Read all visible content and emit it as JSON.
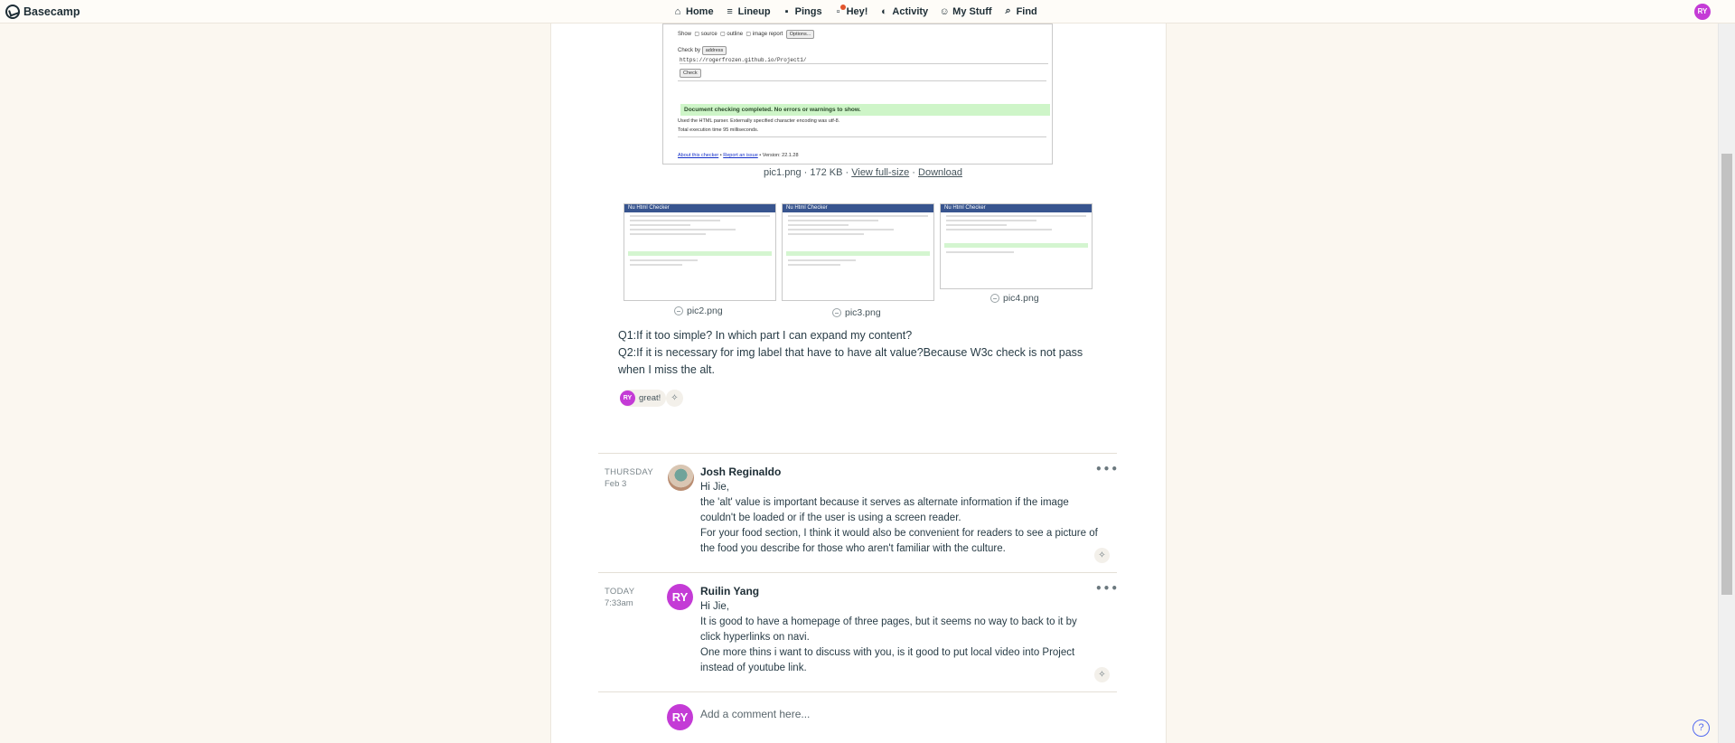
{
  "app": {
    "name": "Basecamp"
  },
  "nav": {
    "items": [
      {
        "label": "Home",
        "icon": "home-icon"
      },
      {
        "label": "Lineup",
        "icon": "lineup-icon"
      },
      {
        "label": "Pings",
        "icon": "pings-icon"
      },
      {
        "label": "Hey!",
        "icon": "hey-icon"
      },
      {
        "label": "Activity",
        "icon": "activity-icon"
      },
      {
        "label": "My Stuff",
        "icon": "mystuff-icon"
      },
      {
        "label": "Find",
        "icon": "search-icon"
      }
    ],
    "user_initials": "RY"
  },
  "main_image": {
    "caption_name": "pic1.png · 172 KB ·",
    "view_link": "View full-size",
    "separator": "·",
    "download_link": "Download",
    "mock": {
      "title": "Nu Html Checker",
      "show_label": "Show",
      "opt_source": "source",
      "opt_outline": "outline",
      "opt_image": "image report",
      "options_btn": "Options...",
      "checkby_label": "Check by",
      "checkby_value": "address",
      "url": "https://rogerfrozen.github.io/Project1/",
      "check_btn": "Check",
      "result": "Document checking completed. No errors or warnings to show.",
      "parser_note": "Used the HTML parser. Externally specified character encoding was utf-8.",
      "time_note": "Total execution time 95 milliseconds.",
      "about_link": "About this checker",
      "report_link": "Report an issue",
      "version": "Version: 22.1.28"
    }
  },
  "thumbnails": [
    {
      "name": "pic2.png"
    },
    {
      "name": "pic3.png"
    },
    {
      "name": "pic4.png"
    }
  ],
  "thumb_title": "Nu Html Checker",
  "post_text": {
    "q1": "Q1:If it too simple? In which part I can expand my content?",
    "q2": "Q2:If it is necessary for img label that have to have  alt value?Because W3c check is not pass when I miss the alt."
  },
  "boost": {
    "initials": "RY",
    "text": "great!"
  },
  "comments": [
    {
      "day": "THURSDAY",
      "date": "Feb 3",
      "author": "Josh Reginaldo",
      "lines": [
        "Hi Jie,",
        "the 'alt' value is important because it serves as alternate information if the image couldn't be loaded or if the user is using a screen reader.",
        "For your food section, I think it would also be convenient for readers to see a picture of the food you describe for those who aren't familiar with the culture."
      ]
    },
    {
      "day": "TODAY",
      "date": "7:33am",
      "author": "Ruilin Yang",
      "initials": "RY",
      "lines": [
        "Hi Jie,",
        "It is good to have a homepage of three pages, but it seems no way to back to it by click hyperlinks on navi.",
        "One more thins i want to discuss with you, is it good to put local video into Project instead of youtube link."
      ]
    }
  ],
  "new_comment": {
    "initials": "RY",
    "placeholder": "Add a comment here..."
  },
  "more_label": "•••",
  "help_label": "?",
  "colors": {
    "accent": "#c43bd6",
    "background": "#fbf7f0",
    "checker_header": "#38558f",
    "success": "#cef5c8"
  }
}
